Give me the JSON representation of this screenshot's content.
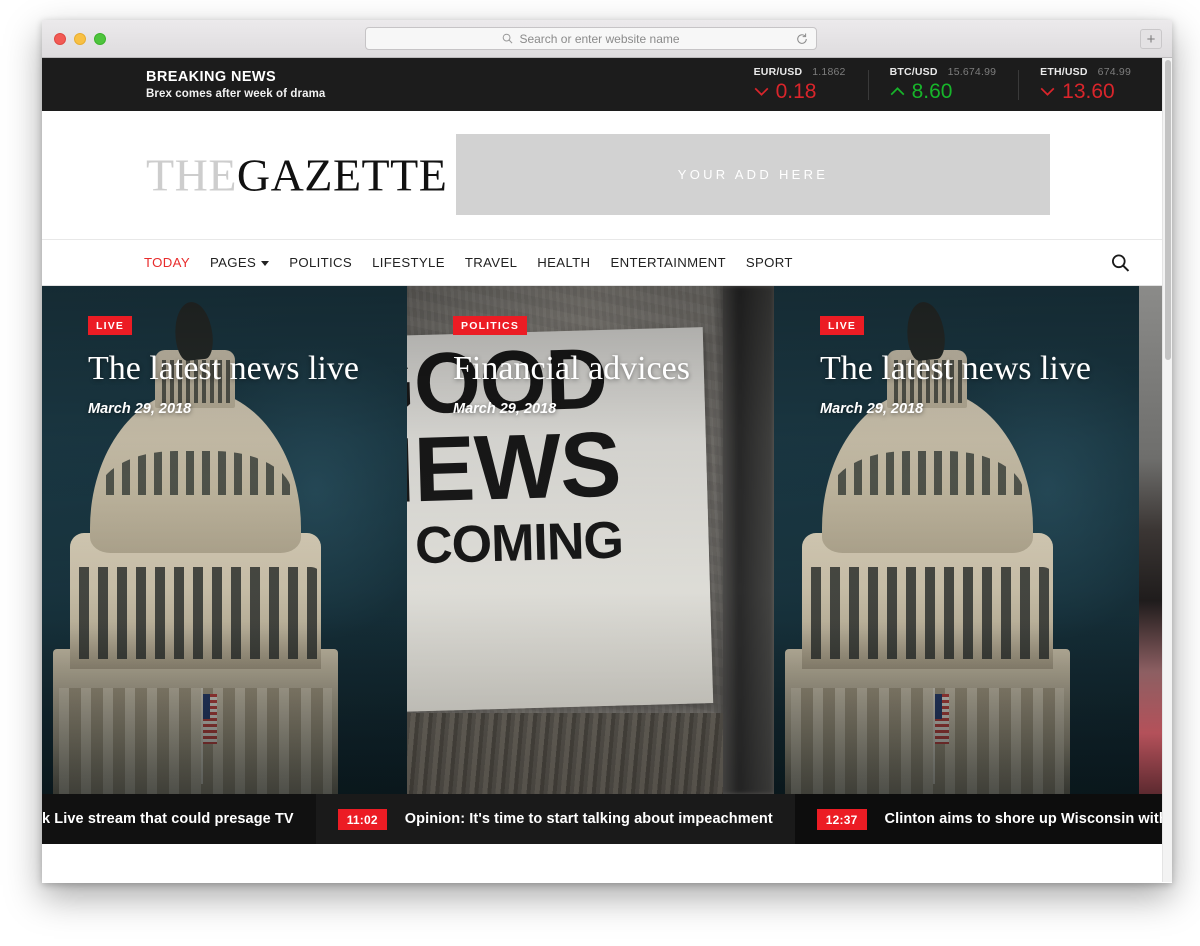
{
  "browser": {
    "address_placeholder": "Search or enter website name",
    "search_icon": "search-icon",
    "reload_icon": "reload-icon",
    "newtab_label": "+",
    "traffic_lights": [
      "close",
      "minimize",
      "zoom"
    ]
  },
  "breaking": {
    "title": "BREAKING NEWS",
    "subtitle": "Brex comes after week of drama",
    "quotes": [
      {
        "pair": "EUR/USD",
        "price": "1.1862",
        "delta": "0.18",
        "direction": "down"
      },
      {
        "pair": "BTC/USD",
        "price": "15.674.99",
        "delta": "8.60",
        "direction": "up"
      },
      {
        "pair": "ETH/USD",
        "price": "674.99",
        "delta": "13.60",
        "direction": "down"
      }
    ]
  },
  "masthead": {
    "logo_light": "THE",
    "logo_dark": "GAZETTE",
    "ad_label": "YOUR ADD HERE"
  },
  "nav": {
    "items": [
      {
        "label": "TODAY",
        "active": true,
        "dropdown": false
      },
      {
        "label": "PAGES",
        "active": false,
        "dropdown": true
      },
      {
        "label": "POLITICS",
        "active": false,
        "dropdown": false
      },
      {
        "label": "LIFESTYLE",
        "active": false,
        "dropdown": false
      },
      {
        "label": "TRAVEL",
        "active": false,
        "dropdown": false
      },
      {
        "label": "HEALTH",
        "active": false,
        "dropdown": false
      },
      {
        "label": "ENTERTAINMENT",
        "active": false,
        "dropdown": false
      },
      {
        "label": "SPORT",
        "active": false,
        "dropdown": false
      }
    ],
    "search_icon": "search-icon"
  },
  "hero": {
    "slides": [
      {
        "badge": "LIVE",
        "title": "The latest news live",
        "date": "March 29, 2018",
        "art": "capitol"
      },
      {
        "badge": "POLITICS",
        "title": "Financial advices",
        "date": "March 29, 2018",
        "art": "poster",
        "poster_lines": [
          "GOOD",
          "NEWS",
          "IS COMING"
        ]
      },
      {
        "badge": "LIVE",
        "title": "The latest news live",
        "date": "March 29, 2018",
        "art": "capitol"
      }
    ]
  },
  "ticker": {
    "items": [
      {
        "time": "",
        "text": "k Live stream that could presage TV"
      },
      {
        "time": "11:02",
        "text": "Opinion: It's time to start talking about impeachment"
      },
      {
        "time": "12:37",
        "text": "Clinton aims to shore up Wisconsin with new TV ads"
      }
    ]
  },
  "colors": {
    "accent_red": "#ec1c24",
    "nav_active": "#e82c2c",
    "up_green": "#17b52a",
    "down_red": "#d9252b",
    "dark_bar": "#1c1c1c"
  }
}
